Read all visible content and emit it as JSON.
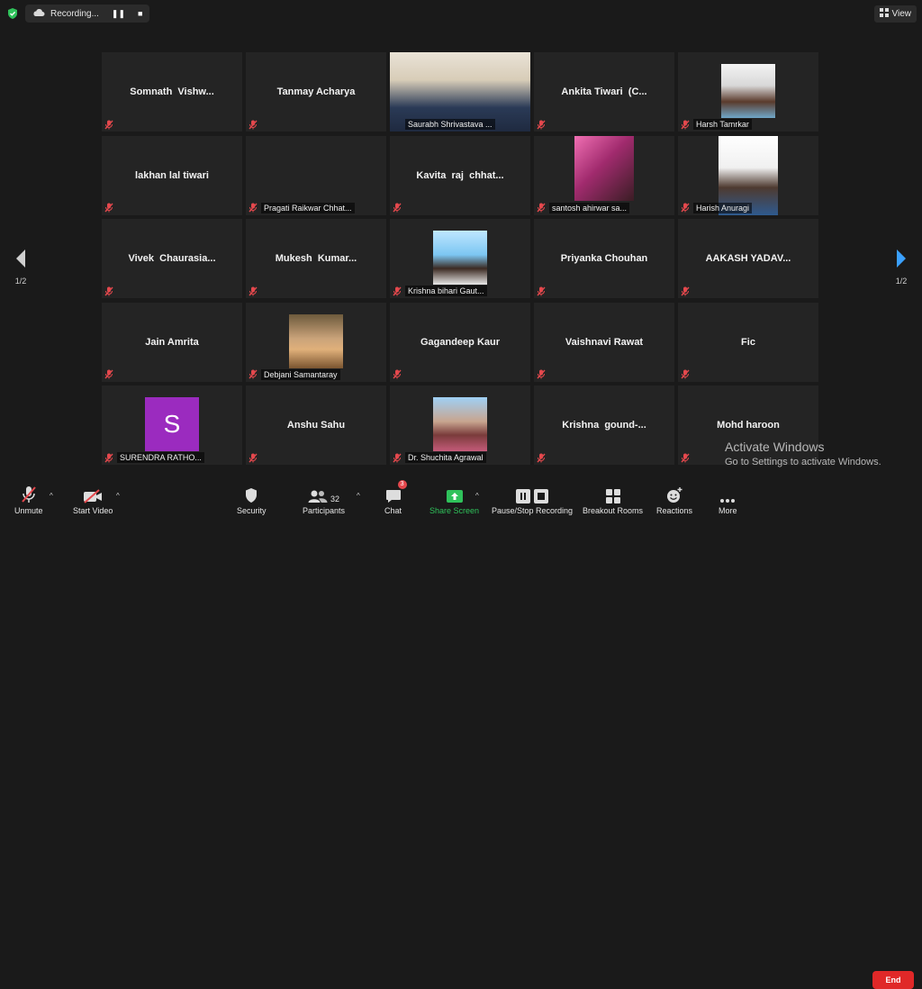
{
  "top": {
    "recording_label": "Recording...",
    "view_label": "View"
  },
  "navigation": {
    "left_page": "1/2",
    "right_page": "1/2"
  },
  "tiles": [
    {
      "name": "Somnath  Vishw...",
      "display": "center"
    },
    {
      "name": "Tanmay Acharya",
      "display": "center"
    },
    {
      "name": "Saurabh Shrivastava ...",
      "display": "video"
    },
    {
      "name": "Ankita Tiwari  (C...",
      "display": "center"
    },
    {
      "name": "Harsh Tamrkar",
      "display": "photo"
    },
    {
      "name": "lakhan lal tiwari",
      "display": "center"
    },
    {
      "name": "Pragati Raikwar Chhat...",
      "display": "label-only"
    },
    {
      "name": "Kavita  raj  chhat...",
      "display": "center"
    },
    {
      "name": "santosh ahirwar sa...",
      "display": "photo"
    },
    {
      "name": "Harish Anuragi",
      "display": "photo"
    },
    {
      "name": "Vivek  Chaurasia...",
      "display": "center"
    },
    {
      "name": "Mukesh  Kumar...",
      "display": "center"
    },
    {
      "name": "Krishna bihari Gaut...",
      "display": "photo"
    },
    {
      "name": "Priyanka Chouhan",
      "display": "center"
    },
    {
      "name": "AAKASH YADAV...",
      "display": "center"
    },
    {
      "name": "Jain Amrita",
      "display": "center"
    },
    {
      "name": "Debjani Samantaray",
      "display": "photo"
    },
    {
      "name": "Gagandeep Kaur",
      "display": "center"
    },
    {
      "name": "Vaishnavi Rawat",
      "display": "center"
    },
    {
      "name": "Fic",
      "display": "center"
    },
    {
      "name": "SURENDRA RATHO...",
      "display": "avatar",
      "avatar_letter": "S"
    },
    {
      "name": "Anshu Sahu",
      "display": "center"
    },
    {
      "name": "Dr. Shuchita Agrawal",
      "display": "photo"
    },
    {
      "name": "Krishna  gound-...",
      "display": "center"
    },
    {
      "name": "Mohd haroon",
      "display": "center"
    }
  ],
  "watermark": {
    "title": "Activate Windows",
    "subtitle": "Go to Settings to activate Windows."
  },
  "toolbar": {
    "unmute": "Unmute",
    "start_video": "Start Video",
    "security": "Security",
    "participants": "Participants",
    "participants_count": "32",
    "chat": "Chat",
    "chat_badge": "3",
    "share_screen": "Share Screen",
    "recording": "Pause/Stop Recording",
    "breakout": "Breakout Rooms",
    "reactions": "Reactions",
    "more": "More",
    "end": "End"
  },
  "colors": {
    "active_speaker_border": "#d4d46a",
    "share_green": "#2fc25b",
    "end_red": "#e02828",
    "mute_red": "#e5484d"
  }
}
